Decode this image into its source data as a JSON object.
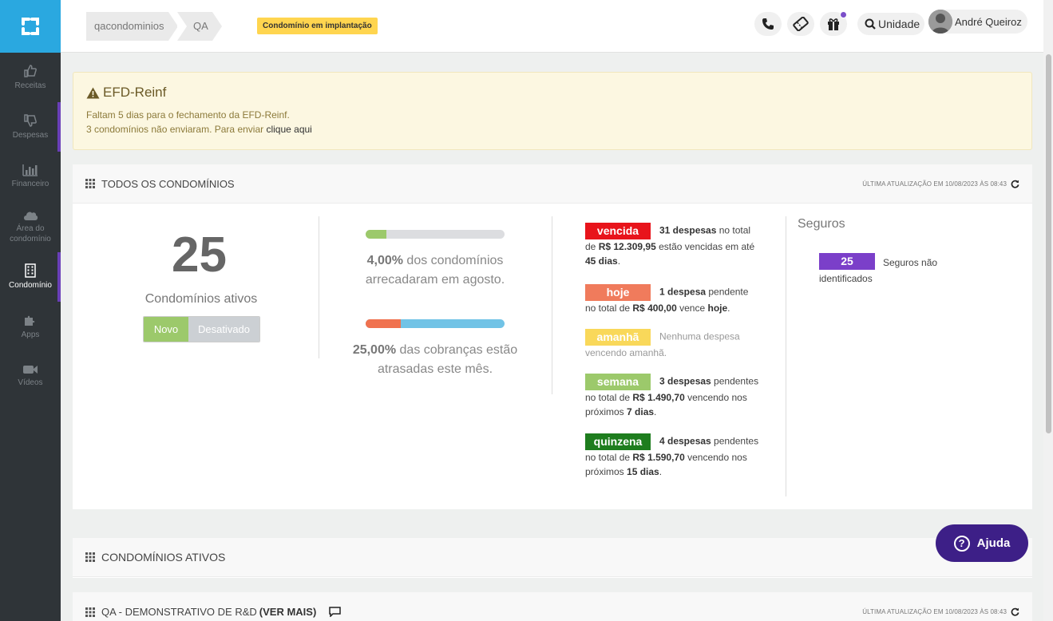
{
  "sidebar": {
    "items": [
      {
        "label": "Receitas",
        "icon": "thumbs-up-icon"
      },
      {
        "label": "Despesas",
        "icon": "thumbs-down-icon"
      },
      {
        "label": "Financeiro",
        "icon": "bar-chart-icon"
      },
      {
        "label": "Área do condomínio",
        "icon": "cloud-icon"
      },
      {
        "label": "Condomínio",
        "icon": "building-icon"
      },
      {
        "label": "Apps",
        "icon": "puzzle-icon"
      },
      {
        "label": "Vídeos",
        "icon": "video-camera-icon"
      }
    ]
  },
  "header": {
    "breadcrumbs": [
      "qacondominios",
      "QA"
    ],
    "badge": "Condomínio em implantação",
    "unidade": "Unidade",
    "user_name": "André Queiroz"
  },
  "alert": {
    "title": "EFD-Reinf",
    "line1": "Faltam 5 dias para o fechamento da EFD-Reinf.",
    "line2": "3 condomínios não enviaram. Para enviar",
    "link": "clique aqui"
  },
  "todos": {
    "title": "TODOS OS CONDOMÍNIOS",
    "updated": "ÚLTIMA ATUALIZAÇÃO EM 10/08/2023 ÀS 08:43",
    "count": "25",
    "count_label": "Condomínios ativos",
    "toggle_on": "Novo",
    "toggle_off": "Desativado",
    "stat1_pct": "4,00%",
    "stat1_line1": " dos condomínios",
    "stat1_line2": "arrecadaram em agosto.",
    "stat1_fill": 0.04,
    "stat2_pct": "25,00%",
    "stat2_line1": " das cobranças estão",
    "stat2_line2": "atrasadas este mês.",
    "stat2_fill": 0.25,
    "due": {
      "vencida": {
        "tag": "vencida",
        "strong": "31 despesas",
        "t1": " no total de ",
        "amount": "R$ 12.309,95",
        "t2": " estão vencidas em até ",
        "days": "45 dias",
        "t3": "."
      },
      "hoje": {
        "tag": "hoje",
        "strong": "1 despesa",
        "t1": " pendente no total de ",
        "amount": "R$ 400,00",
        "t2": " vence ",
        "days": "hoje",
        "t3": "."
      },
      "amanha": {
        "tag": "amanhã",
        "text": "Nenhuma despesa vencendo amanhã."
      },
      "semana": {
        "tag": "semana",
        "strong": "3 despesas",
        "t1": " pendentes no total de ",
        "amount": "R$ 1.490,70",
        "t2": " vencendo nos próximos ",
        "days": "7 dias",
        "t3": "."
      },
      "quinzena": {
        "tag": "quinzena",
        "strong": "4 despesas",
        "t1": " pendentes no total de ",
        "amount": "R$ 1.590,70",
        "t2": " vencendo nos próximos ",
        "days": "15 dias",
        "t3": "."
      }
    },
    "seguros_title": "Seguros",
    "seguros_count": "25",
    "seguros_text": "Seguros não identificados"
  },
  "ativos": {
    "title": "CONDOMÍNIOS ATIVOS"
  },
  "qa": {
    "title": "QA - DEMONSTRATIVO DE R&D ",
    "more": "(VER MAIS)",
    "updated": "ÚLTIMA ATUALIZAÇÃO EM 10/08/2023 ÀS 08:43"
  },
  "help": {
    "label": "Ajuda"
  },
  "colors": {
    "brand": "#2aa8e0",
    "sidebar": "#2f3438",
    "purple": "#6a3fb8",
    "vencida": "#e8141b",
    "hoje": "#f07b5c",
    "amanha": "#f9d85a",
    "semana": "#9cc96b",
    "quinzena": "#1e7d1e",
    "bar_green": "#9cc96b",
    "bar_red": "#f0724f",
    "bar_blue": "#71c3e6"
  }
}
